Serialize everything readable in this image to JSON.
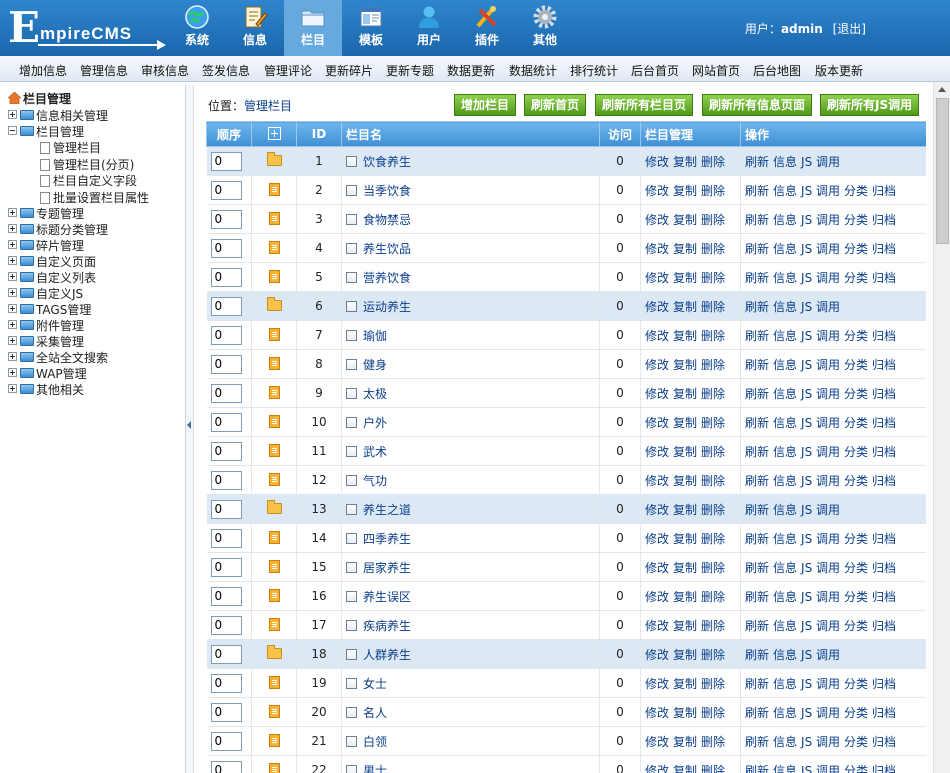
{
  "logo": {
    "initial": "E",
    "rest": "mpireCMS"
  },
  "modules": [
    {
      "label": "系统",
      "icon": "globe-icon",
      "active": false
    },
    {
      "label": "信息",
      "icon": "document-edit-icon",
      "active": false
    },
    {
      "label": "栏目",
      "icon": "folder-icon",
      "active": true
    },
    {
      "label": "模板",
      "icon": "template-window-icon",
      "active": false
    },
    {
      "label": "用户",
      "icon": "user-icon",
      "active": false
    },
    {
      "label": "插件",
      "icon": "tools-icon",
      "active": false
    },
    {
      "label": "其他",
      "icon": "gear-icon",
      "active": false
    }
  ],
  "user": {
    "prefix": "用户：",
    "name": "admin",
    "logout": "[退出]"
  },
  "menubar": [
    "增加信息",
    "管理信息",
    "审核信息",
    "签发信息",
    "管理评论",
    "更新碎片",
    "更新专题",
    "数据更新",
    "数据统计",
    "排行统计",
    "后台首页",
    "网站首页",
    "后台地图",
    "版本更新"
  ],
  "sidebar": {
    "title": "栏目管理",
    "nodes": [
      {
        "label": "信息相关管理",
        "expanded": false
      },
      {
        "label": "栏目管理",
        "expanded": true,
        "children": [
          "管理栏目",
          "管理栏目(分页)",
          "栏目自定义字段",
          "批量设置栏目属性"
        ]
      },
      {
        "label": "专题管理",
        "expanded": false
      },
      {
        "label": "标题分类管理",
        "expanded": false
      },
      {
        "label": "碎片管理",
        "expanded": false
      },
      {
        "label": "自定义页面",
        "expanded": false
      },
      {
        "label": "自定义列表",
        "expanded": false
      },
      {
        "label": "自定义JS",
        "expanded": false
      },
      {
        "label": "TAGS管理",
        "expanded": false
      },
      {
        "label": "附件管理",
        "expanded": false
      },
      {
        "label": "采集管理",
        "expanded": false
      },
      {
        "label": "全站全文搜索",
        "expanded": false
      },
      {
        "label": "WAP管理",
        "expanded": false
      },
      {
        "label": "其他相关",
        "expanded": false
      }
    ]
  },
  "breadcrumb": {
    "prefix": "位置：",
    "link": "管理栏目"
  },
  "actions": [
    "增加栏目",
    "刷新首页",
    "刷新所有栏目页",
    "刷新所有信息页面",
    "刷新所有JS调用"
  ],
  "table": {
    "headers": {
      "order": "顺序",
      "id": "ID",
      "name": "栏目名",
      "visits": "访问",
      "manage": "栏目管理",
      "ops": "操作"
    },
    "manage_links": [
      "修改",
      "复制",
      "删除"
    ],
    "ops_parent": [
      "刷新",
      "信息",
      "JS 调用"
    ],
    "ops_child": [
      "刷新",
      "信息",
      "JS 调用",
      "分类",
      "归档"
    ],
    "rows": [
      {
        "order": "0",
        "id": "1",
        "name": "饮食养生",
        "visits": "0",
        "parent": true
      },
      {
        "order": "0",
        "id": "2",
        "name": "当季饮食",
        "visits": "0",
        "parent": false
      },
      {
        "order": "0",
        "id": "3",
        "name": "食物禁忌",
        "visits": "0",
        "parent": false
      },
      {
        "order": "0",
        "id": "4",
        "name": "养生饮品",
        "visits": "0",
        "parent": false
      },
      {
        "order": "0",
        "id": "5",
        "name": "营养饮食",
        "visits": "0",
        "parent": false
      },
      {
        "order": "0",
        "id": "6",
        "name": "运动养生",
        "visits": "0",
        "parent": true
      },
      {
        "order": "0",
        "id": "7",
        "name": "瑜伽",
        "visits": "0",
        "parent": false
      },
      {
        "order": "0",
        "id": "8",
        "name": "健身",
        "visits": "0",
        "parent": false
      },
      {
        "order": "0",
        "id": "9",
        "name": "太极",
        "visits": "0",
        "parent": false
      },
      {
        "order": "0",
        "id": "10",
        "name": "户外",
        "visits": "0",
        "parent": false
      },
      {
        "order": "0",
        "id": "11",
        "name": "武术",
        "visits": "0",
        "parent": false
      },
      {
        "order": "0",
        "id": "12",
        "name": "气功",
        "visits": "0",
        "parent": false
      },
      {
        "order": "0",
        "id": "13",
        "name": "养生之道",
        "visits": "0",
        "parent": true
      },
      {
        "order": "0",
        "id": "14",
        "name": "四季养生",
        "visits": "0",
        "parent": false
      },
      {
        "order": "0",
        "id": "15",
        "name": "居家养生",
        "visits": "0",
        "parent": false
      },
      {
        "order": "0",
        "id": "16",
        "name": "养生误区",
        "visits": "0",
        "parent": false
      },
      {
        "order": "0",
        "id": "17",
        "name": "疾病养生",
        "visits": "0",
        "parent": false
      },
      {
        "order": "0",
        "id": "18",
        "name": "人群养生",
        "visits": "0",
        "parent": true
      },
      {
        "order": "0",
        "id": "19",
        "name": "女士",
        "visits": "0",
        "parent": false
      },
      {
        "order": "0",
        "id": "20",
        "name": "名人",
        "visits": "0",
        "parent": false
      },
      {
        "order": "0",
        "id": "21",
        "name": "白领",
        "visits": "0",
        "parent": false
      },
      {
        "order": "0",
        "id": "22",
        "name": "男士",
        "visits": "0",
        "parent": false
      }
    ]
  }
}
